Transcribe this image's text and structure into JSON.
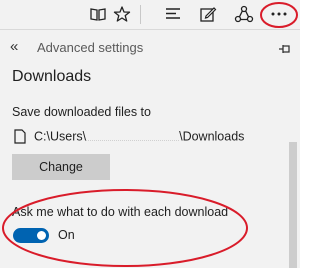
{
  "toolbar": {
    "icons": [
      "reading-view-icon",
      "favorite-star-icon",
      "hub-icon",
      "web-note-icon",
      "share-icon",
      "more-icon"
    ]
  },
  "panel": {
    "back_glyph": "«",
    "title": "Advanced settings",
    "pin_icon": "pin-icon"
  },
  "downloads": {
    "section_title": "Downloads",
    "save_label": "Save downloaded files to",
    "path_prefix": "C:\\Users\\",
    "path_suffix": "\\Downloads",
    "change_label": "Change",
    "ask_label": "Ask me what to do with each download",
    "toggle_state": "On",
    "toggle_on": true
  },
  "colors": {
    "accent": "#0063b1",
    "highlight": "#d91c2a",
    "panel_bg": "#f2f2f2",
    "button_bg": "#cccccc"
  }
}
